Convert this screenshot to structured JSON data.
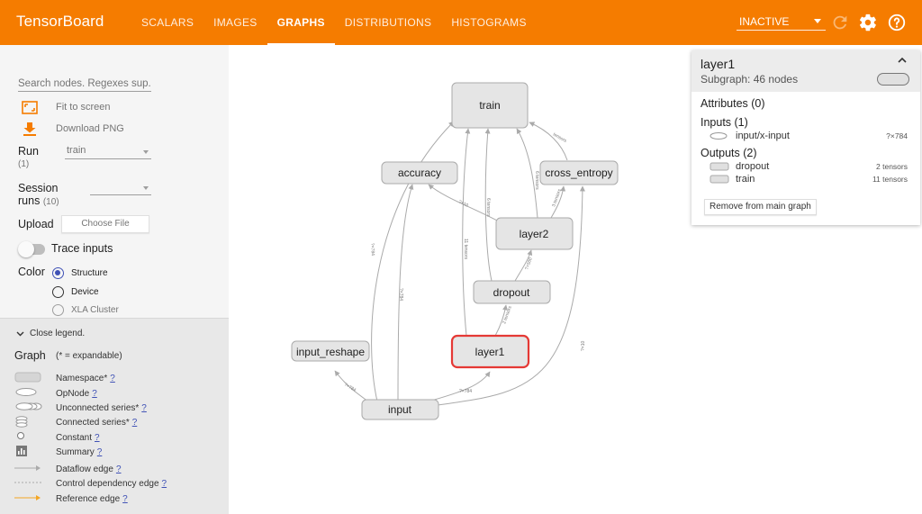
{
  "app": {
    "title": "TensorBoard",
    "status": "INACTIVE",
    "colors": {
      "header": "#f57c00",
      "accent": "#3f51b5",
      "selected_node": "#e53935"
    },
    "icons": [
      "refresh-icon",
      "settings-gear-icon",
      "help-icon"
    ]
  },
  "nav": {
    "tabs": [
      {
        "label": "SCALARS",
        "active": false
      },
      {
        "label": "IMAGES",
        "active": false
      },
      {
        "label": "GRAPHS",
        "active": true
      },
      {
        "label": "DISTRIBUTIONS",
        "active": false
      },
      {
        "label": "HISTOGRAMS",
        "active": false
      }
    ]
  },
  "sidebar": {
    "search_placeholder": "Search nodes. Regexes sup...",
    "fit_label": "Fit to screen",
    "download_label": "Download PNG",
    "run_label": "Run",
    "run_count": "(1)",
    "run_value": "train",
    "session_label": "Session",
    "session_label2": "runs",
    "session_count": "(10)",
    "session_value": "",
    "upload_label": "Upload",
    "choose_file": "Choose File",
    "trace_label": "Trace inputs",
    "color_label": "Color",
    "color_options": [
      {
        "label": "Structure",
        "checked": true,
        "disabled": false
      },
      {
        "label": "Device",
        "checked": false,
        "disabled": false
      },
      {
        "label": "XLA Cluster",
        "checked": false,
        "disabled": true
      }
    ]
  },
  "legend": {
    "close_label": "Close legend.",
    "graph_label": "Graph",
    "expandable_note": "(* = expandable)",
    "items": [
      {
        "label": "Namespace*",
        "help": "?"
      },
      {
        "label": "OpNode",
        "help": "?"
      },
      {
        "label": "Unconnected series*",
        "help": "?"
      },
      {
        "label": "Connected series*",
        "help": "?"
      },
      {
        "label": "Constant",
        "help": "?"
      },
      {
        "label": "Summary",
        "help": "?"
      },
      {
        "label": "Dataflow edge",
        "help": "?"
      },
      {
        "label": "Control dependency edge",
        "help": "?"
      },
      {
        "label": "Reference edge",
        "help": "?"
      }
    ]
  },
  "graph": {
    "nodes": {
      "train": "train",
      "accuracy": "accuracy",
      "cross_entropy": "cross_entropy",
      "layer2": "layer2",
      "dropout": "dropout",
      "layer1": "layer1",
      "input_reshape": "input_reshape",
      "input": "input"
    },
    "edge_labels": {
      "e1": "?×784",
      "e2": "?×784",
      "e3": "?×10",
      "e4": "?×10",
      "e5": "11 tensors",
      "e6": "6 tensors",
      "e7": "6 tensors",
      "e8": "?×10",
      "e9": "3 tensors",
      "e10": "?×500",
      "e11": "2 tensors",
      "e12": "?×784",
      "e13": "?×10",
      "e14": "tensors"
    }
  },
  "info": {
    "title": "layer1",
    "subtitle": "Subgraph: 46 nodes",
    "attributes": "Attributes (0)",
    "inputs_title": "Inputs (1)",
    "inputs": [
      {
        "name": "input/x-input",
        "size": "?×784"
      }
    ],
    "outputs_title": "Outputs (2)",
    "outputs": [
      {
        "name": "dropout",
        "size": "2 tensors"
      },
      {
        "name": "train",
        "size": "11 tensors"
      }
    ],
    "remove_label": "Remove from main graph"
  }
}
